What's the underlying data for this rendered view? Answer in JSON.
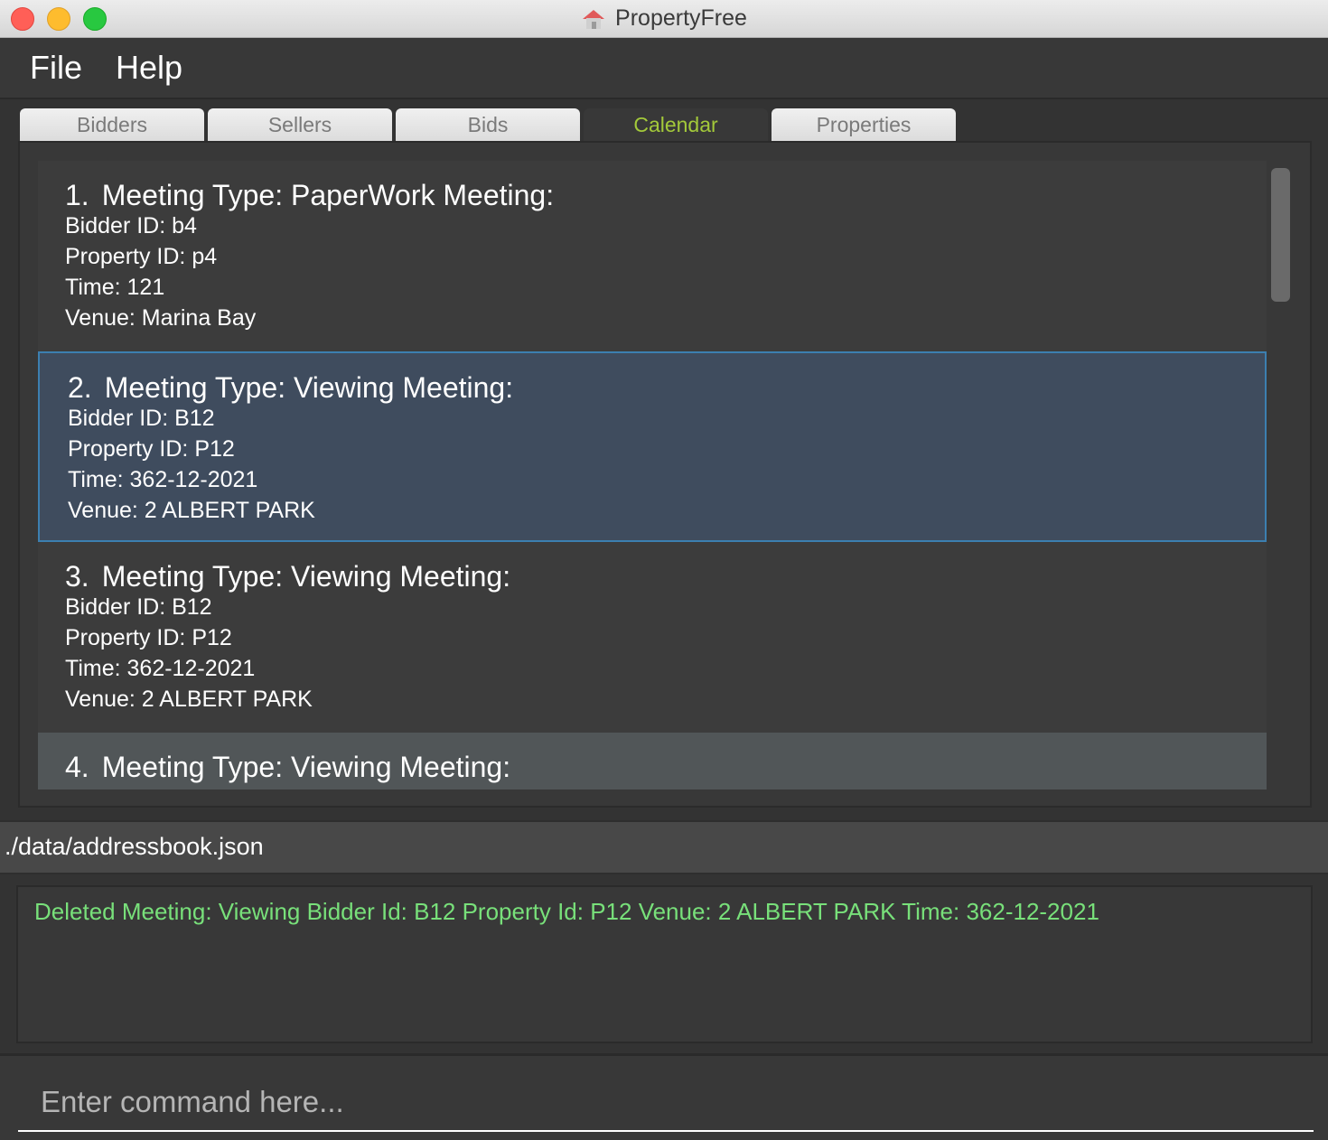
{
  "window": {
    "title": "PropertyFree"
  },
  "menu": {
    "file": "File",
    "help": "Help"
  },
  "tabs": [
    {
      "label": "Bidders",
      "selected": false
    },
    {
      "label": "Sellers",
      "selected": false
    },
    {
      "label": "Bids",
      "selected": false
    },
    {
      "label": "Calendar",
      "selected": true
    },
    {
      "label": "Properties",
      "selected": false
    }
  ],
  "meetings": [
    {
      "index": "1.",
      "type": "Meeting Type: PaperWork Meeting:",
      "bidder": "Bidder ID: b4",
      "property": "Property ID: p4",
      "time": "Time: 121",
      "venue": "Venue: Marina Bay"
    },
    {
      "index": "2.",
      "type": "Meeting Type: Viewing Meeting:",
      "bidder": "Bidder ID: B12",
      "property": "Property ID: P12",
      "time": "Time: 362-12-2021",
      "venue": "Venue: 2 ALBERT PARK"
    },
    {
      "index": "3.",
      "type": "Meeting Type: Viewing Meeting:",
      "bidder": "Bidder ID: B12",
      "property": "Property ID: P12",
      "time": "Time: 362-12-2021",
      "venue": "Venue: 2 ALBERT PARK"
    },
    {
      "index": "4.",
      "type": "Meeting Type: Viewing Meeting:"
    }
  ],
  "status": {
    "path": "./data/addressbook.json"
  },
  "result": {
    "message": "Deleted Meeting: Viewing Bidder Id: B12 Property Id: P12 Venue: 2 ALBERT PARK Time: 362-12-2021"
  },
  "command": {
    "placeholder": "Enter command here..."
  },
  "colors": {
    "accent_tab": "#a3c93a",
    "result_text": "#78e07a",
    "selected_card": "#3f4c5e"
  }
}
